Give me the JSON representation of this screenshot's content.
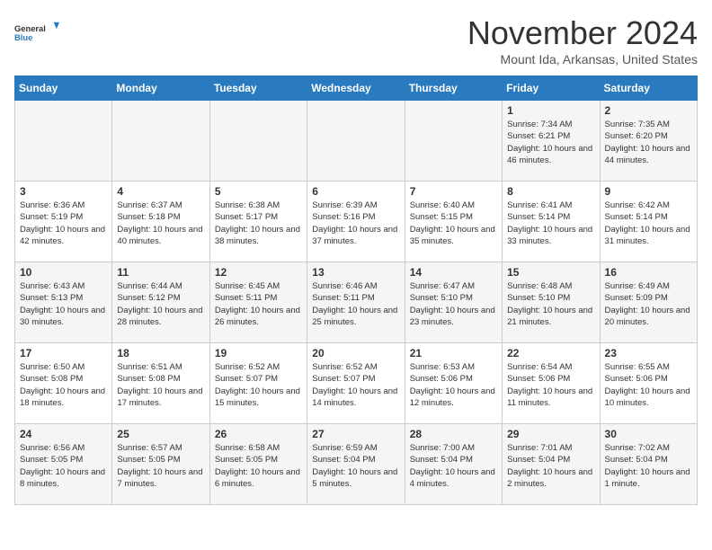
{
  "header": {
    "logo_general": "General",
    "logo_blue": "Blue",
    "month_title": "November 2024",
    "location": "Mount Ida, Arkansas, United States"
  },
  "days_of_week": [
    "Sunday",
    "Monday",
    "Tuesday",
    "Wednesday",
    "Thursday",
    "Friday",
    "Saturday"
  ],
  "weeks": [
    [
      {
        "day": "",
        "info": ""
      },
      {
        "day": "",
        "info": ""
      },
      {
        "day": "",
        "info": ""
      },
      {
        "day": "",
        "info": ""
      },
      {
        "day": "",
        "info": ""
      },
      {
        "day": "1",
        "info": "Sunrise: 7:34 AM\nSunset: 6:21 PM\nDaylight: 10 hours and 46 minutes."
      },
      {
        "day": "2",
        "info": "Sunrise: 7:35 AM\nSunset: 6:20 PM\nDaylight: 10 hours and 44 minutes."
      }
    ],
    [
      {
        "day": "3",
        "info": "Sunrise: 6:36 AM\nSunset: 5:19 PM\nDaylight: 10 hours and 42 minutes."
      },
      {
        "day": "4",
        "info": "Sunrise: 6:37 AM\nSunset: 5:18 PM\nDaylight: 10 hours and 40 minutes."
      },
      {
        "day": "5",
        "info": "Sunrise: 6:38 AM\nSunset: 5:17 PM\nDaylight: 10 hours and 38 minutes."
      },
      {
        "day": "6",
        "info": "Sunrise: 6:39 AM\nSunset: 5:16 PM\nDaylight: 10 hours and 37 minutes."
      },
      {
        "day": "7",
        "info": "Sunrise: 6:40 AM\nSunset: 5:15 PM\nDaylight: 10 hours and 35 minutes."
      },
      {
        "day": "8",
        "info": "Sunrise: 6:41 AM\nSunset: 5:14 PM\nDaylight: 10 hours and 33 minutes."
      },
      {
        "day": "9",
        "info": "Sunrise: 6:42 AM\nSunset: 5:14 PM\nDaylight: 10 hours and 31 minutes."
      }
    ],
    [
      {
        "day": "10",
        "info": "Sunrise: 6:43 AM\nSunset: 5:13 PM\nDaylight: 10 hours and 30 minutes."
      },
      {
        "day": "11",
        "info": "Sunrise: 6:44 AM\nSunset: 5:12 PM\nDaylight: 10 hours and 28 minutes."
      },
      {
        "day": "12",
        "info": "Sunrise: 6:45 AM\nSunset: 5:11 PM\nDaylight: 10 hours and 26 minutes."
      },
      {
        "day": "13",
        "info": "Sunrise: 6:46 AM\nSunset: 5:11 PM\nDaylight: 10 hours and 25 minutes."
      },
      {
        "day": "14",
        "info": "Sunrise: 6:47 AM\nSunset: 5:10 PM\nDaylight: 10 hours and 23 minutes."
      },
      {
        "day": "15",
        "info": "Sunrise: 6:48 AM\nSunset: 5:10 PM\nDaylight: 10 hours and 21 minutes."
      },
      {
        "day": "16",
        "info": "Sunrise: 6:49 AM\nSunset: 5:09 PM\nDaylight: 10 hours and 20 minutes."
      }
    ],
    [
      {
        "day": "17",
        "info": "Sunrise: 6:50 AM\nSunset: 5:08 PM\nDaylight: 10 hours and 18 minutes."
      },
      {
        "day": "18",
        "info": "Sunrise: 6:51 AM\nSunset: 5:08 PM\nDaylight: 10 hours and 17 minutes."
      },
      {
        "day": "19",
        "info": "Sunrise: 6:52 AM\nSunset: 5:07 PM\nDaylight: 10 hours and 15 minutes."
      },
      {
        "day": "20",
        "info": "Sunrise: 6:52 AM\nSunset: 5:07 PM\nDaylight: 10 hours and 14 minutes."
      },
      {
        "day": "21",
        "info": "Sunrise: 6:53 AM\nSunset: 5:06 PM\nDaylight: 10 hours and 12 minutes."
      },
      {
        "day": "22",
        "info": "Sunrise: 6:54 AM\nSunset: 5:06 PM\nDaylight: 10 hours and 11 minutes."
      },
      {
        "day": "23",
        "info": "Sunrise: 6:55 AM\nSunset: 5:06 PM\nDaylight: 10 hours and 10 minutes."
      }
    ],
    [
      {
        "day": "24",
        "info": "Sunrise: 6:56 AM\nSunset: 5:05 PM\nDaylight: 10 hours and 8 minutes."
      },
      {
        "day": "25",
        "info": "Sunrise: 6:57 AM\nSunset: 5:05 PM\nDaylight: 10 hours and 7 minutes."
      },
      {
        "day": "26",
        "info": "Sunrise: 6:58 AM\nSunset: 5:05 PM\nDaylight: 10 hours and 6 minutes."
      },
      {
        "day": "27",
        "info": "Sunrise: 6:59 AM\nSunset: 5:04 PM\nDaylight: 10 hours and 5 minutes."
      },
      {
        "day": "28",
        "info": "Sunrise: 7:00 AM\nSunset: 5:04 PM\nDaylight: 10 hours and 4 minutes."
      },
      {
        "day": "29",
        "info": "Sunrise: 7:01 AM\nSunset: 5:04 PM\nDaylight: 10 hours and 2 minutes."
      },
      {
        "day": "30",
        "info": "Sunrise: 7:02 AM\nSunset: 5:04 PM\nDaylight: 10 hours and 1 minute."
      }
    ]
  ]
}
